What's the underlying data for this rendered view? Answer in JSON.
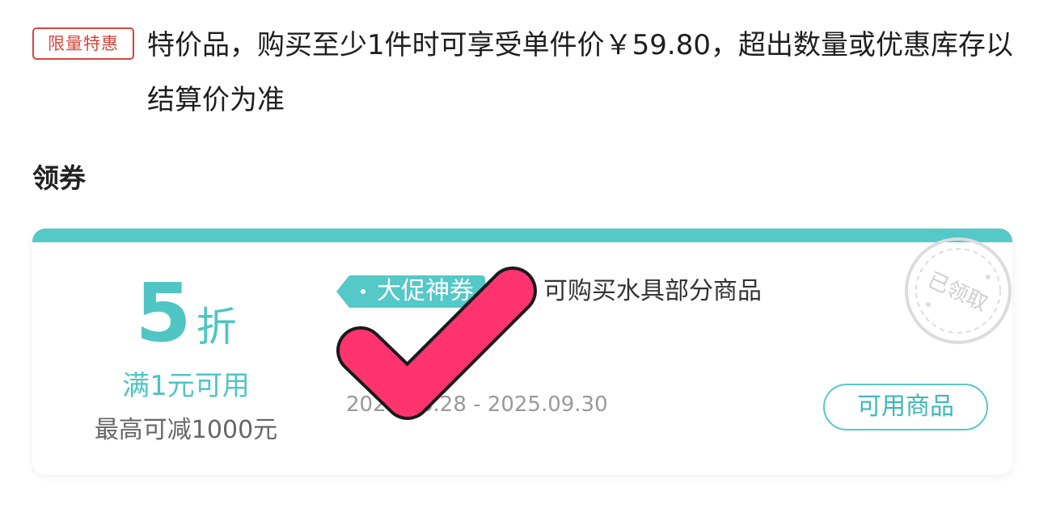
{
  "promo": {
    "badge": "限量特惠",
    "text": "特价品，购买至少1件时可享受单件价￥59.80，超出数量或优惠库存以结算价为准"
  },
  "section": {
    "title": "领券"
  },
  "coupon": {
    "discount_value": "5",
    "discount_unit": "折",
    "threshold": "满1元可用",
    "max_reduce": "最高可减1000元",
    "tag": "大促神券",
    "description": "可购买水具部分商品",
    "date_range": "2025.08.28 - 2025.09.30",
    "products_button": "可用商品",
    "stamp_text": "已领取"
  },
  "colors": {
    "accent": "#55c8c8",
    "promo_red": "#d6453a",
    "check_mark": "#ff3370"
  },
  "icons": {
    "check_mark": "check-mark-icon",
    "stamp": "received-stamp-icon"
  }
}
